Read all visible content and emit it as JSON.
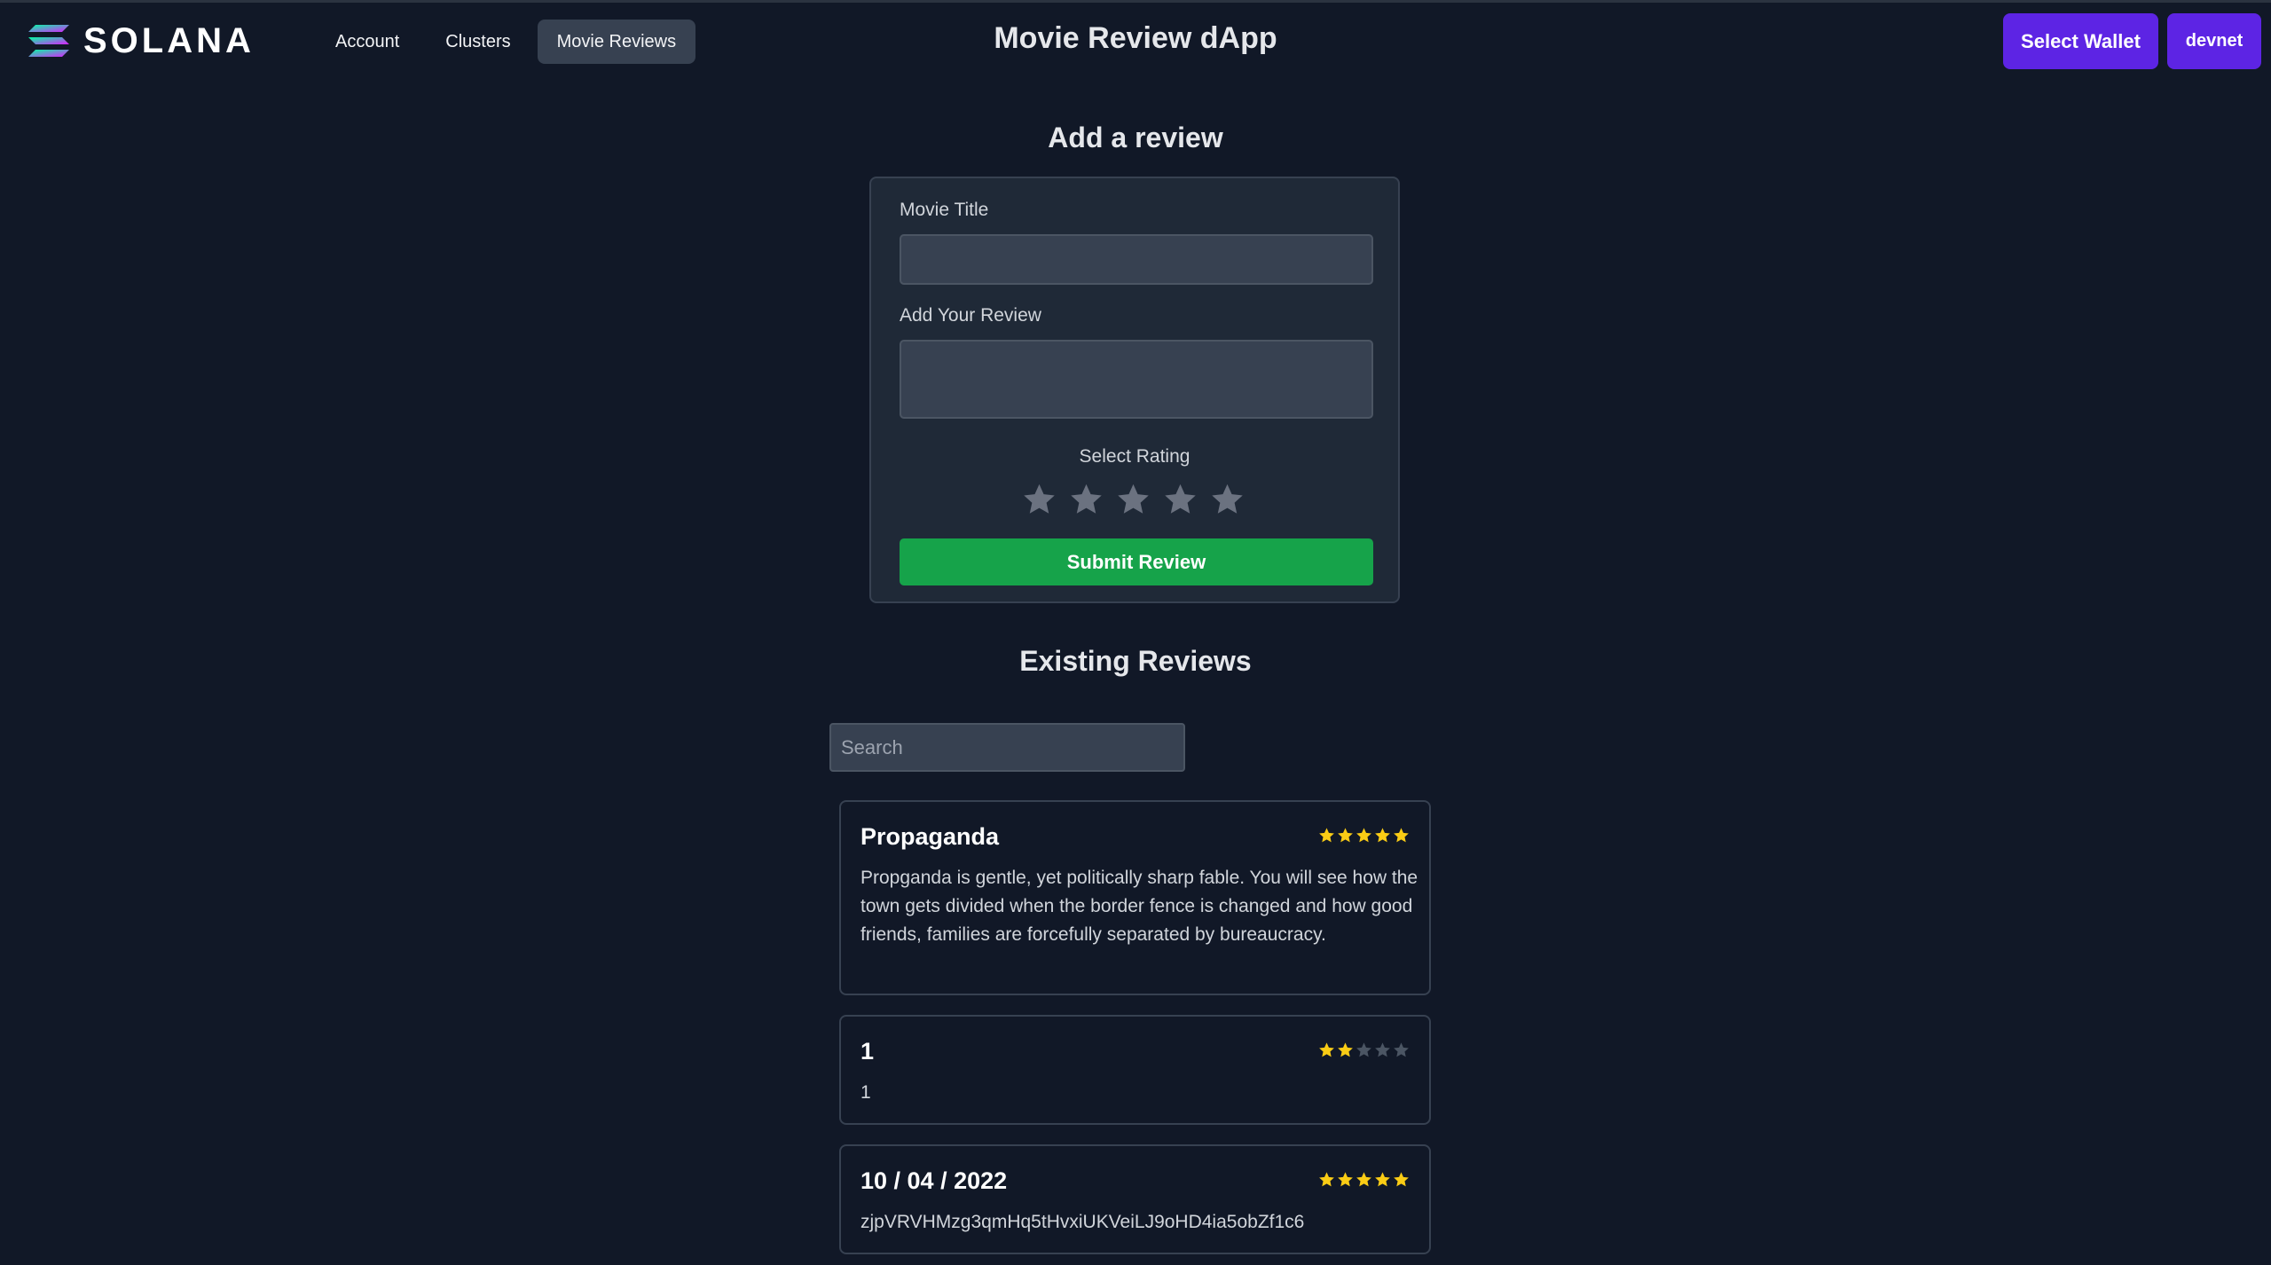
{
  "header": {
    "logo_text": "SOLANA",
    "nav": [
      {
        "label": "Account",
        "active": false
      },
      {
        "label": "Clusters",
        "active": false
      },
      {
        "label": "Movie Reviews",
        "active": true
      }
    ],
    "app_title": "Movie Review dApp",
    "wallet_button": "Select Wallet",
    "cluster_button": "devnet"
  },
  "form": {
    "heading": "Add a review",
    "title_label": "Movie Title",
    "title_value": "",
    "review_label": "Add Your Review",
    "review_value": "",
    "rating_label": "Select Rating",
    "rating_max": 5,
    "rating_selected": 0,
    "submit_label": "Submit Review"
  },
  "reviews": {
    "heading": "Existing Reviews",
    "search_placeholder": "Search",
    "search_value": "",
    "items": [
      {
        "title": "Propaganda",
        "rating": 5,
        "text": "Propganda is gentle, yet politically sharp fable. You will see how the town gets divided when the border fence is changed and how good friends, families are forcefully separated by bureaucracy."
      },
      {
        "title": "1",
        "rating": 2,
        "text": "1"
      },
      {
        "title": "10 / 04 / 2022",
        "rating": 5,
        "text": "zjpVRVHMzg3qmHq5tHvxiUKVeiLJ9oHD4ia5obZf1c6"
      }
    ]
  },
  "colors": {
    "background": "#111827",
    "card": "#1f2937",
    "accent_purple": "#5d24e4",
    "submit_green": "#16a34a",
    "star_filled": "#facc15",
    "star_empty": "#4b5563"
  }
}
